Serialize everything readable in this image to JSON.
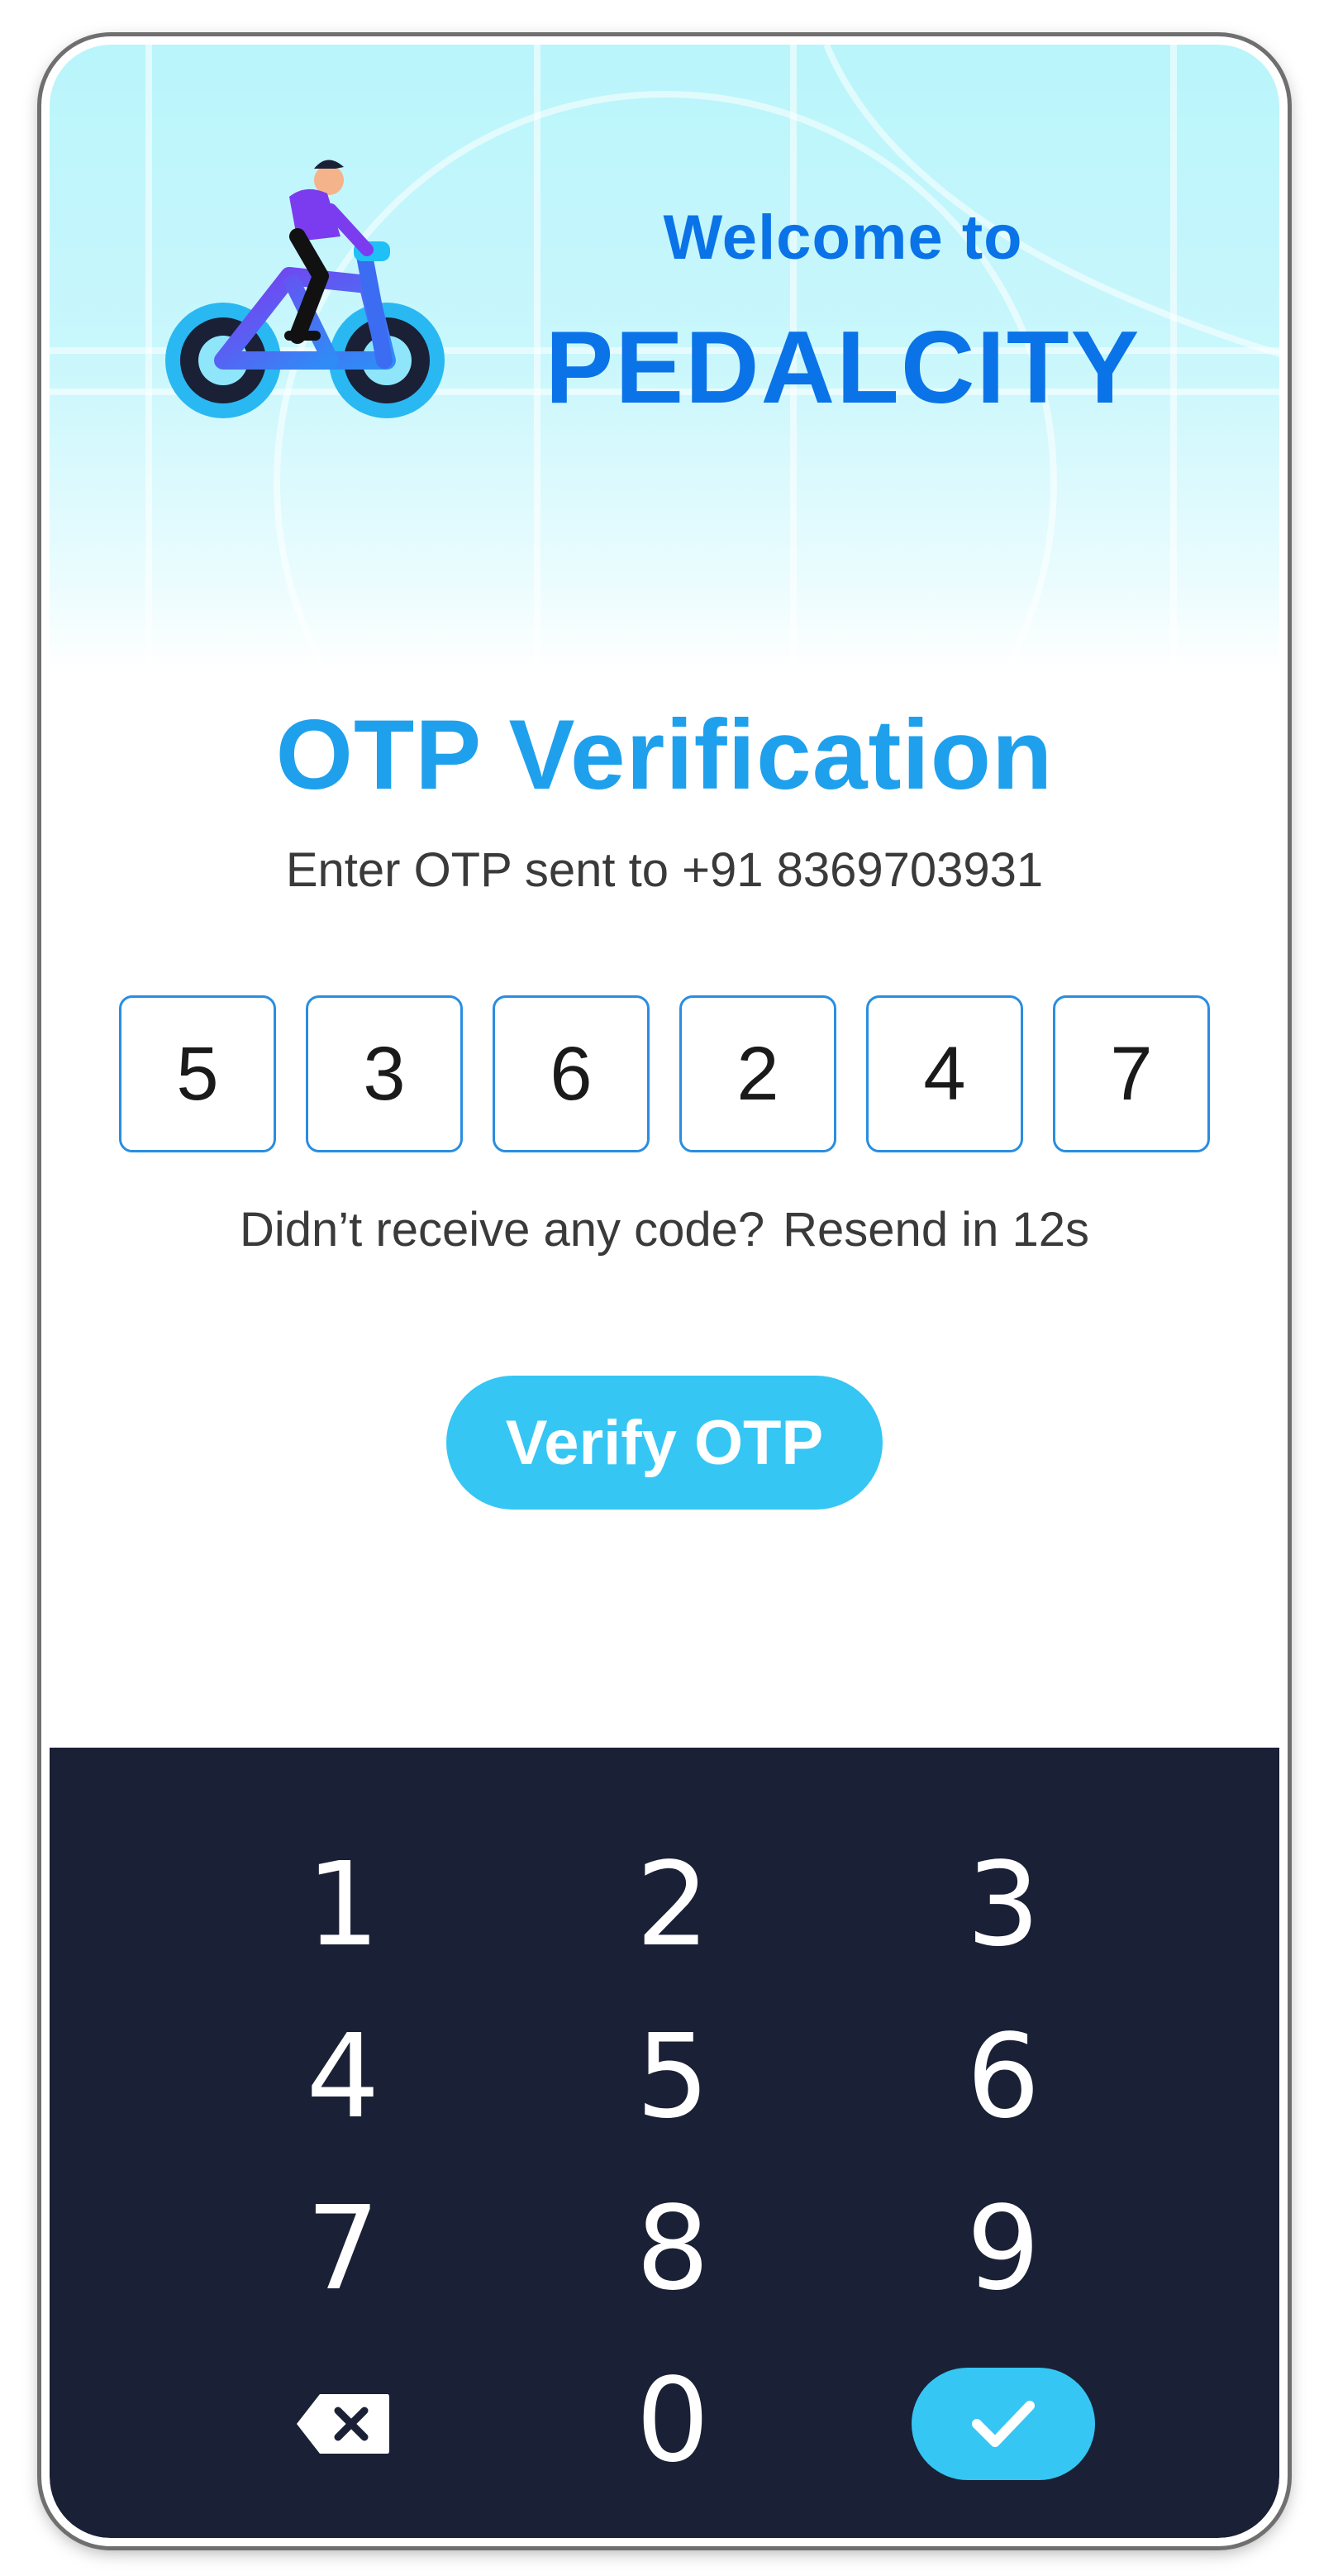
{
  "header": {
    "welcome": "Welcome to",
    "brand": "PEDALCITY"
  },
  "main": {
    "title": "OTP Verification",
    "subtitle": "Enter OTP sent to +91 8369703931",
    "otp_digits": [
      "5",
      "3",
      "6",
      "2",
      "4",
      "7"
    ],
    "resend_prompt": "Didn’t receive any code?",
    "resend_timer": "Resend in 12s",
    "verify_label": "Verify OTP"
  },
  "keypad": {
    "keys": [
      "1",
      "2",
      "3",
      "4",
      "5",
      "6",
      "7",
      "8",
      "9",
      "0"
    ],
    "backspace_icon": "backspace-icon",
    "confirm_icon": "check-icon"
  },
  "colors": {
    "brand_blue": "#0b73e8",
    "title_blue": "#1fa0ec",
    "accent_cyan": "#35c6f4",
    "keypad_bg": "#1a2035"
  }
}
